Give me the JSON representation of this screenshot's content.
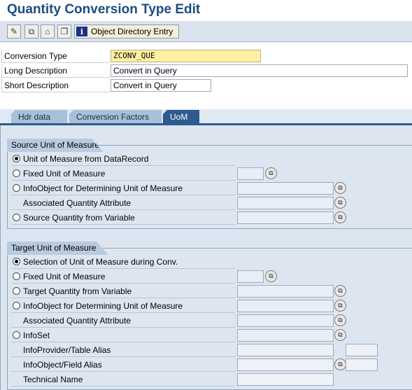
{
  "page_title": "Quantity Conversion Type Edit",
  "toolbar": {
    "buttons": [
      "display-change-icon",
      "other-object-icon",
      "activate-icon",
      "copy-icon"
    ],
    "object_directory_label": "Object Directory Entry"
  },
  "header": {
    "conversion_type_label": "Conversion Type",
    "conversion_type_value": "ZCONV_QUE",
    "long_desc_label": "Long Description",
    "long_desc_value": "Convert in Query",
    "short_desc_label": "Short Description",
    "short_desc_value": "Convert in Query"
  },
  "tabs": [
    {
      "label": "Hdr data",
      "active": false
    },
    {
      "label": "Conversion Factors",
      "active": false
    },
    {
      "label": "UoM",
      "active": true
    }
  ],
  "source": {
    "title": "Source Unit of Measure",
    "opt_datarecord": "Unit of Measure from DataRecord",
    "opt_fixed": "Fixed Unit of Measure",
    "opt_infoobject": "InfoObject for Determining Unit of Measure",
    "assoc_attr": "Associated Quantity Attribute",
    "opt_variable": "Source Quantity from Variable"
  },
  "target": {
    "title": "Target Unit of Measure",
    "opt_selection": "Selection of Unit of Measure during Conv.",
    "opt_fixed": "Fixed Unit of Measure",
    "opt_variable": "Target Quantity from Variable",
    "opt_infoobject": "InfoObject for Determining Unit of Measure",
    "assoc_attr": "Associated Quantity Attribute",
    "opt_infoset": "InfoSet",
    "infoprovider_alias": "InfoProvider/Table Alias",
    "infoobject_alias": "InfoObject/Field Alias",
    "technical_name": "Technical Name"
  },
  "colors": {
    "title": "#1d4c83",
    "active_tab": "#2d5a8f",
    "required_field": "#fff0a0"
  }
}
